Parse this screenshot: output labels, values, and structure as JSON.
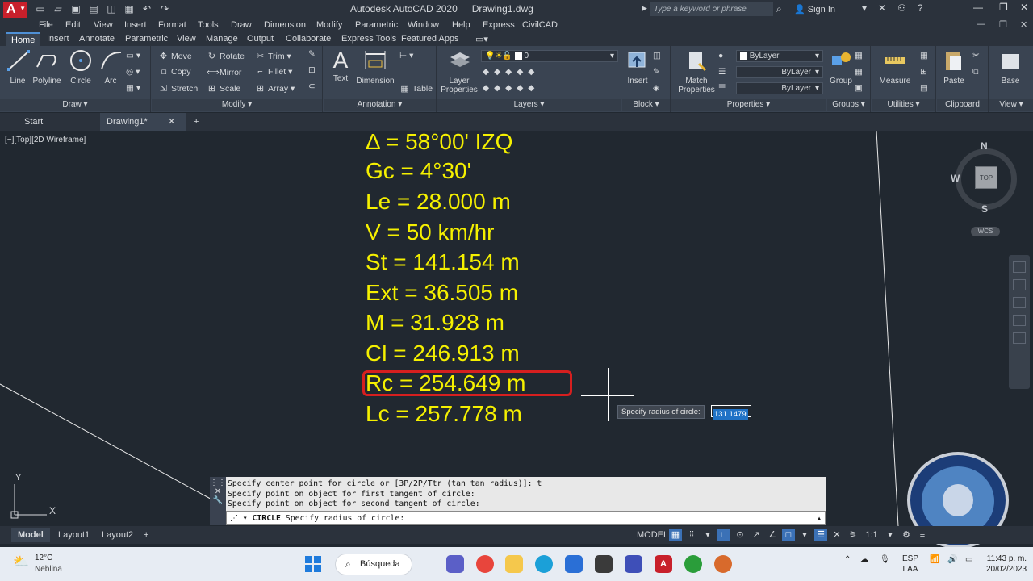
{
  "titlebar": {
    "app_logo": "A",
    "app_name": "Autodesk AutoCAD 2020",
    "doc_name": "Drawing1.dwg",
    "search_placeholder": "Type a keyword or phrase",
    "signin": "Sign In"
  },
  "menu": [
    "File",
    "Edit",
    "View",
    "Insert",
    "Format",
    "Tools",
    "Draw",
    "Dimension",
    "Modify",
    "Parametric",
    "Window",
    "Help",
    "Express",
    "CivilCAD"
  ],
  "ribbon_tabs": [
    "Home",
    "Insert",
    "Annotate",
    "Parametric",
    "View",
    "Manage",
    "Output",
    "Collaborate",
    "Express Tools",
    "Featured Apps"
  ],
  "ribbon": {
    "draw": {
      "line": "Line",
      "polyline": "Polyline",
      "circle": "Circle",
      "arc": "Arc",
      "title": "Draw"
    },
    "modify": {
      "move": "Move",
      "rotate": "Rotate",
      "trim": "Trim",
      "copy": "Copy",
      "mirror": "Mirror",
      "fillet": "Fillet",
      "stretch": "Stretch",
      "scale": "Scale",
      "array": "Array",
      "title": "Modify"
    },
    "annotation": {
      "text": "Text",
      "dimension": "Dimension",
      "table": "Table",
      "title": "Annotation"
    },
    "layers": {
      "layer_properties_1": "Layer",
      "layer_properties_2": "Properties",
      "current_layer": "0",
      "title": "Layers"
    },
    "block": {
      "insert": "Insert",
      "title": "Block"
    },
    "properties": {
      "match_1": "Match",
      "match_2": "Properties",
      "color": "ByLayer",
      "linetype": "ByLayer",
      "lineweight": "ByLayer",
      "title": "Properties"
    },
    "groups": {
      "group": "Group",
      "title": "Groups"
    },
    "utilities": {
      "measure": "Measure",
      "title": "Utilities"
    },
    "clipboard": {
      "paste": "Paste",
      "title": "Clipboard"
    },
    "view": {
      "base": "Base",
      "title": "View"
    }
  },
  "file_tabs": {
    "start": "Start",
    "drawing": "Drawing1*"
  },
  "viewport": {
    "label": "[−][Top][2D Wireframe]"
  },
  "curve_data": [
    "Δ = 58°00' IZQ",
    "Gc = 4°30'",
    "Le = 28.000 m",
    "V = 50 km/hr",
    "St = 141.154 m",
    "Ext = 36.505 m",
    "M = 31.928 m",
    "Cl = 246.913 m",
    "Rc = 254.649 m",
    "Lc = 257.778 m"
  ],
  "dynamic_input": {
    "prompt": "Specify radius of circle:",
    "value": "131.1479"
  },
  "viewcube": {
    "n": "N",
    "s": "S",
    "w": "W",
    "face": "TOP",
    "wcs": "WCS"
  },
  "ucs": {
    "x": "X",
    "y": "Y"
  },
  "command_history": [
    "Specify center point for circle or [3P/2P/Ttr (tan tan radius)]: t",
    "Specify point on object for first tangent of circle:",
    "Specify point on object for second tangent of circle:"
  ],
  "command_input": {
    "command": "CIRCLE",
    "prompt": "Specify radius of circle:"
  },
  "layout_tabs": [
    "Model",
    "Layout1",
    "Layout2"
  ],
  "status": {
    "model": "MODEL",
    "scale": "1:1"
  },
  "taskbar": {
    "temp": "12°C",
    "weather": "Neblina",
    "search": "Búsqueda",
    "lang1": "ESP",
    "lang2": "LAA",
    "time": "11:43 p. m.",
    "date": "20/02/2023"
  },
  "colors": {
    "cad_text": "#f5f000",
    "highlight": "#d61f1f",
    "background": "#212830"
  }
}
